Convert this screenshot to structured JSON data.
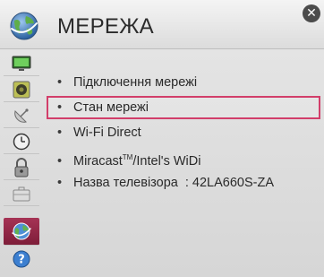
{
  "header": {
    "title": "МЕРЕЖА",
    "icon": "network-globe-icon",
    "close_icon": "close-icon"
  },
  "sidebar": {
    "items": [
      {
        "name": "picture-icon",
        "active": false
      },
      {
        "name": "sound-icon",
        "active": false
      },
      {
        "name": "channel-dish-icon",
        "active": false
      },
      {
        "name": "clock-icon",
        "active": false
      },
      {
        "name": "lock-icon",
        "active": false
      },
      {
        "name": "options-case-icon",
        "active": false
      },
      {
        "name": "network-icon",
        "active": true
      },
      {
        "name": "support-icon",
        "active": false
      }
    ]
  },
  "menu": {
    "items": [
      {
        "label": "Підключення мережі"
      },
      {
        "label": "Стан мережі"
      },
      {
        "label": "Wi-Fi Direct"
      },
      {
        "label": "Miracast",
        "trademark": "TM",
        "label_suffix": "/Intel's WiDi"
      },
      {
        "label": "Назва телевізора",
        "value": ": 42LA660S-ZA"
      }
    ],
    "selected_index": 1
  },
  "colors": {
    "accent": "#d23e6a",
    "active_sidebar": "#8e2443"
  }
}
